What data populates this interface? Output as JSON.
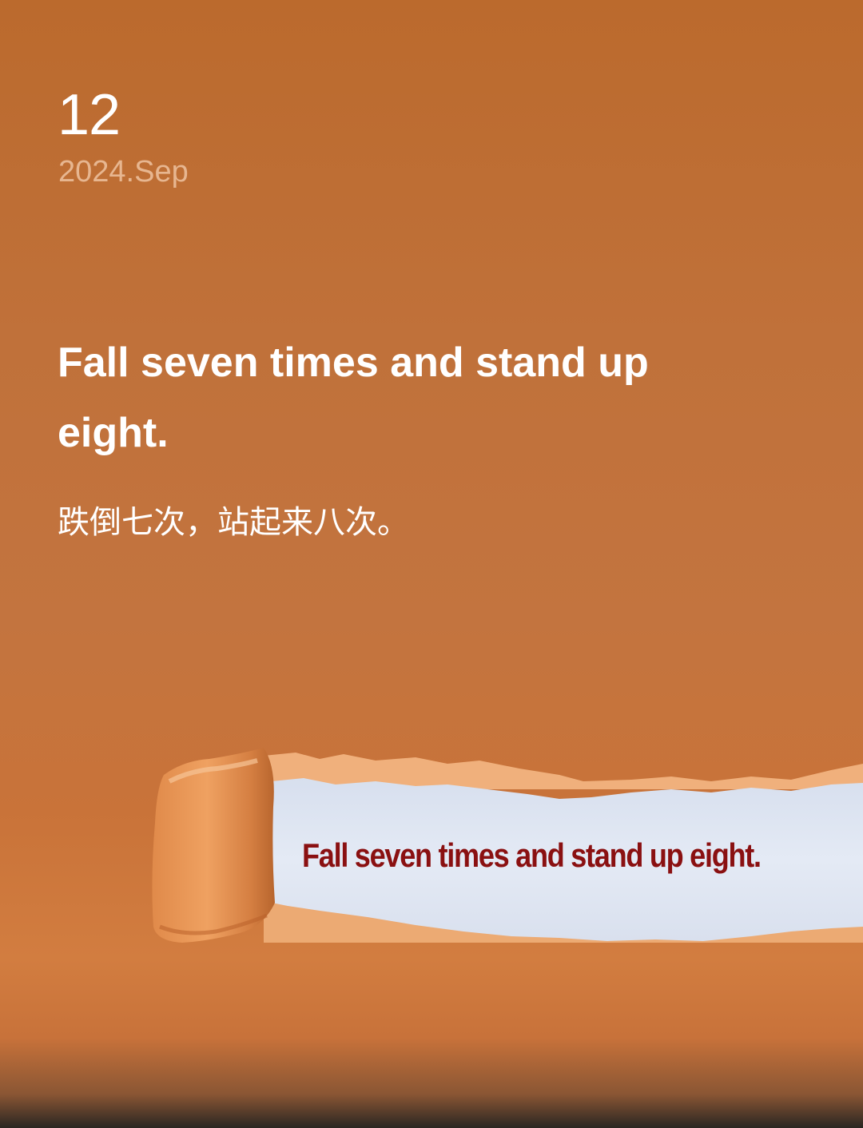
{
  "date": {
    "day": "12",
    "month": "2024.Sep"
  },
  "quote": {
    "english": "Fall seven times and stand up eight.",
    "chinese": "跌倒七次，站起来八次。"
  },
  "image": {
    "caption": "Fall seven times and stand up eight.",
    "colors": {
      "paper": "#d27d40",
      "reveal": "#dfe6f3",
      "text": "#8a1011"
    }
  }
}
